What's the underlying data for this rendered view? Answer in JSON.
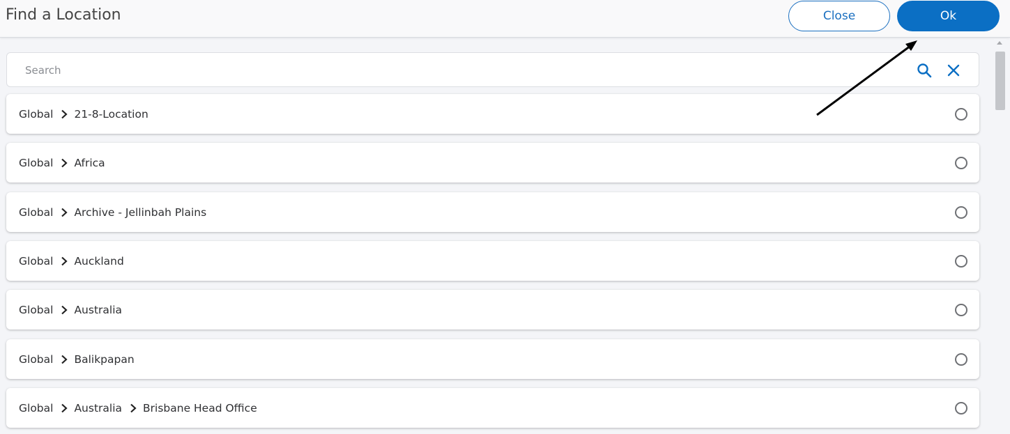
{
  "header": {
    "title": "Find a Location",
    "close_label": "Close",
    "ok_label": "Ok"
  },
  "search": {
    "placeholder": "Search",
    "value": ""
  },
  "locations": [
    {
      "segments": [
        "Global",
        "21-8-Location"
      ]
    },
    {
      "segments": [
        "Global",
        "Africa"
      ]
    },
    {
      "segments": [
        "Global",
        "Archive - Jellinbah Plains"
      ]
    },
    {
      "segments": [
        "Global",
        "Auckland"
      ]
    },
    {
      "segments": [
        "Global",
        "Australia"
      ]
    },
    {
      "segments": [
        "Global",
        "Balikpapan"
      ]
    },
    {
      "segments": [
        "Global",
        "Australia",
        "Brisbane Head Office"
      ]
    }
  ],
  "colors": {
    "accent": "#0b6fc4",
    "radio_border": "#6e7074"
  }
}
